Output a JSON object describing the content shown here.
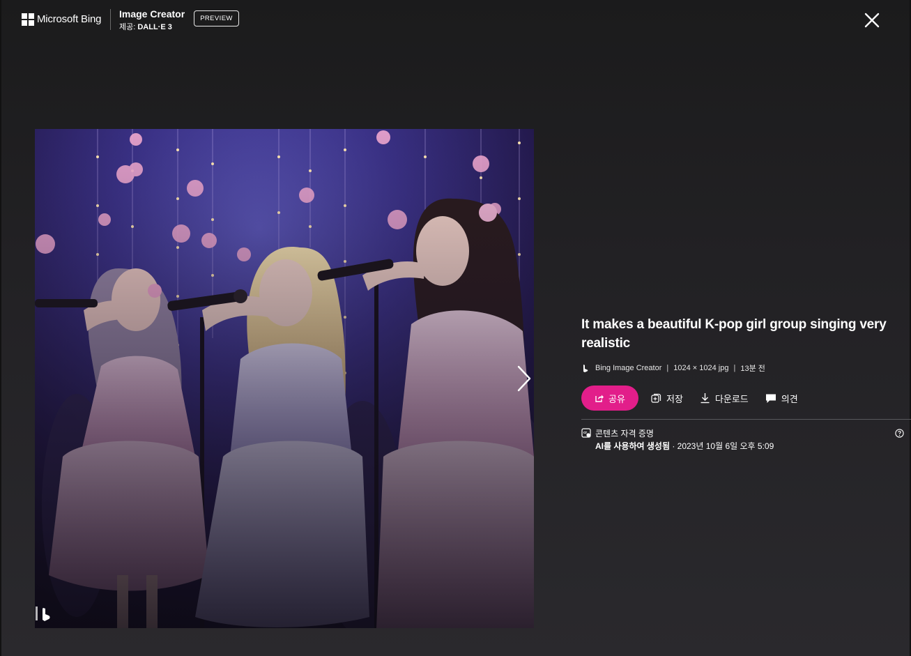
{
  "header": {
    "brand": "Microsoft Bing",
    "app_title": "Image Creator",
    "provider_label": "제공: ",
    "provider_name": "DALL·E 3",
    "preview_badge": "PREVIEW",
    "close_icon": "close-icon"
  },
  "image": {
    "alt": "It makes a beautiful K-pop girl group singing very realistic",
    "watermark_icon": "bing-logo-icon",
    "next_icon": "chevron-right-icon"
  },
  "detail": {
    "title": "It makes a beautiful K-pop girl group singing very realistic",
    "source": "Bing Image Creator",
    "dimensions": "1024 × 1024 jpg",
    "time_ago": "13분 전",
    "separator": "|"
  },
  "actions": {
    "share_label": "공유",
    "save_label": "저장",
    "download_label": "다운로드",
    "feedback_label": "의견",
    "share_color": "#e21e8a"
  },
  "credentials": {
    "title": "콘텐츠 자격 증명",
    "generated_by": "AI를 사용하여 생성됨",
    "date": " · 2023년 10월 6일 오후 5:09",
    "help_icon": "help-icon"
  }
}
